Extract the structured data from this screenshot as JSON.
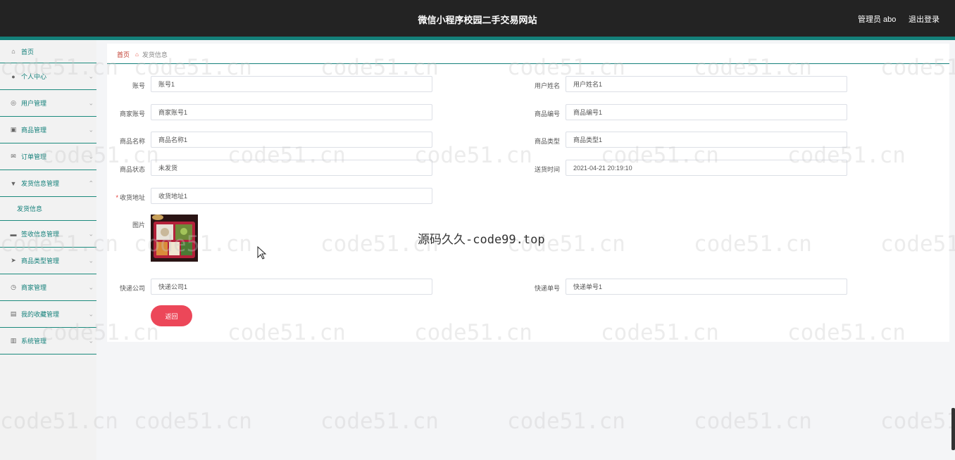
{
  "header": {
    "title": "微信小程序校园二手交易网站",
    "admin_label": "管理员 abo",
    "logout_label": "退出登录"
  },
  "sidebar": {
    "items": [
      {
        "label": "首页",
        "icon": "home-icon"
      },
      {
        "label": "个人中心",
        "icon": "user-icon"
      },
      {
        "label": "用户管理",
        "icon": "info-circle-icon"
      },
      {
        "label": "商品管理",
        "icon": "bag-icon"
      },
      {
        "label": "订单管理",
        "icon": "mail-icon"
      },
      {
        "label": "发货信息管理",
        "icon": "flag-icon"
      },
      {
        "label": "签收信息管理",
        "icon": "chat-icon"
      },
      {
        "label": "商品类型管理",
        "icon": "send-icon"
      },
      {
        "label": "商家管理",
        "icon": "clock-icon"
      },
      {
        "label": "我的收藏管理",
        "icon": "picture-icon"
      },
      {
        "label": "系统管理",
        "icon": "chart-icon"
      }
    ],
    "sub_item": "发货信息"
  },
  "breadcrumb": {
    "home": "首页",
    "current": "发货信息"
  },
  "form": {
    "account": {
      "label": "账号",
      "value": "账号1"
    },
    "user_name": {
      "label": "用户姓名",
      "value": "用户姓名1"
    },
    "merchant_account": {
      "label": "商家账号",
      "value": "商家账号1"
    },
    "product_code": {
      "label": "商品编号",
      "value": "商品编号1"
    },
    "product_name": {
      "label": "商品名称",
      "value": "商品名称1"
    },
    "product_type": {
      "label": "商品类型",
      "value": "商品类型1"
    },
    "product_status": {
      "label": "商品状态",
      "value": "未发货"
    },
    "ship_time": {
      "label": "送货时间",
      "value": "2021-04-21 20:19:10"
    },
    "address": {
      "label": "收货地址",
      "value": "收货地址1",
      "required_mark": "*"
    },
    "picture": {
      "label": "图片"
    },
    "courier": {
      "label": "快递公司",
      "value": "快递公司1"
    },
    "tracking_no": {
      "label": "快递单号",
      "value": "快递单号1"
    },
    "back_button": "返回"
  },
  "watermark": {
    "text": "code51.cn",
    "center_text": "源码久久-code99.top"
  },
  "colors": {
    "accent": "#14807a",
    "header_bg": "#232323",
    "button": "#ec4759"
  }
}
